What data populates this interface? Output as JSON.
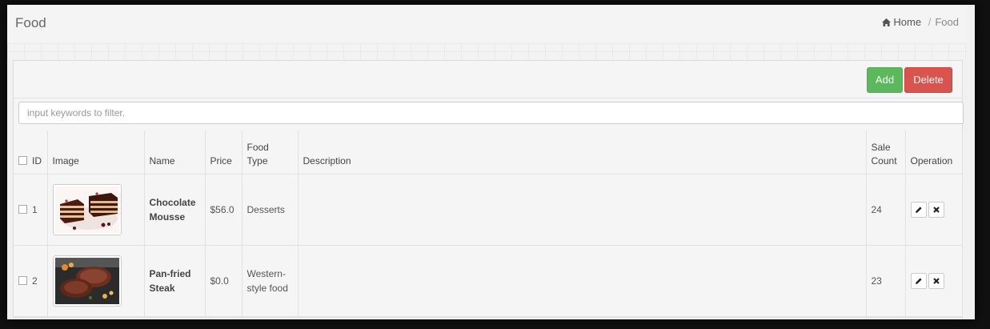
{
  "header": {
    "title": "Food",
    "breadcrumb": {
      "home": "Home",
      "current": "Food"
    }
  },
  "toolbar": {
    "add_label": "Add",
    "delete_label": "Delete"
  },
  "filter": {
    "placeholder": "input keywords to filter."
  },
  "table": {
    "columns": {
      "id": "ID",
      "image": "Image",
      "name": "Name",
      "price": "Price",
      "food_type_1": "Food",
      "food_type_2": "Type",
      "description": "Description",
      "sale_count_1": "Sale",
      "sale_count_2": "Count",
      "operation": "Operation"
    },
    "rows": [
      {
        "id": "1",
        "image": "chocolate-mousse-photo",
        "name_1": "Chocolate",
        "name_2": "Mousse",
        "price": "$56.0",
        "type_1": "Desserts",
        "type_2": "",
        "description": "",
        "sale_count": "24"
      },
      {
        "id": "2",
        "image": "steak-photo",
        "name_1": "Pan-fried",
        "name_2": "Steak",
        "price": "$0.0",
        "type_1": "Western-",
        "type_2": "style food",
        "description": "",
        "sale_count": "23"
      }
    ]
  },
  "icons": {
    "home": "home-icon",
    "edit": "pencil-icon",
    "remove": "close-icon"
  },
  "colors": {
    "add": "#5cb85c",
    "delete": "#d9534f"
  }
}
